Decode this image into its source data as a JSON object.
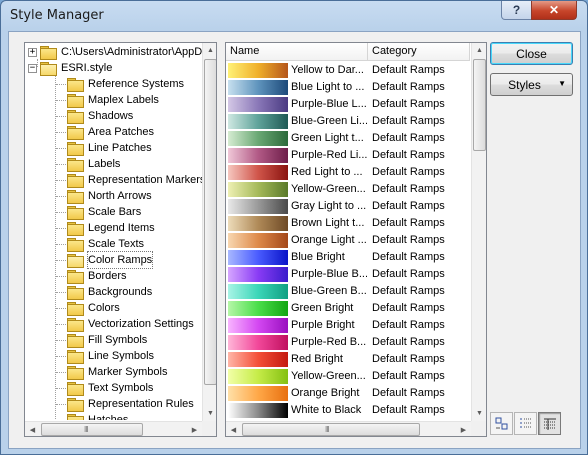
{
  "window": {
    "title": "Style Manager",
    "help_glyph": "?",
    "close_glyph": "✕"
  },
  "tree": {
    "root_path": "C:\\Users\\Administrator\\AppD",
    "style_file": "ESRI.style",
    "items": [
      "Reference Systems",
      "Maplex Labels",
      "Shadows",
      "Area Patches",
      "Line Patches",
      "Labels",
      "Representation Markers",
      "North Arrows",
      "Scale Bars",
      "Legend Items",
      "Scale Texts",
      "Color Ramps",
      "Borders",
      "Backgrounds",
      "Colors",
      "Vectorization Settings",
      "Fill Symbols",
      "Line Symbols",
      "Marker Symbols",
      "Text Symbols",
      "Representation Rules",
      "Hatches"
    ],
    "selected_item": "Color Ramps"
  },
  "list": {
    "columns": [
      "Name",
      "Category"
    ],
    "rows": [
      {
        "name": "Yellow to Dar...",
        "category": "Default Ramps",
        "colors": [
          "#fff176",
          "#f0b02a",
          "#b5561b"
        ]
      },
      {
        "name": "Blue Light to ...",
        "category": "Default Ramps",
        "colors": [
          "#c7e0ef",
          "#5f94bd",
          "#1d4a7a"
        ]
      },
      {
        "name": "Purple-Blue L...",
        "category": "Default Ramps",
        "colors": [
          "#d4c8e6",
          "#8a78b8",
          "#4a3a82"
        ]
      },
      {
        "name": "Blue-Green Li...",
        "category": "Default Ramps",
        "colors": [
          "#cfe8e2",
          "#5fa39a",
          "#1f5a55"
        ]
      },
      {
        "name": "Green Light t...",
        "category": "Default Ramps",
        "colors": [
          "#d6ecd2",
          "#6aa874",
          "#2c6b3b"
        ]
      },
      {
        "name": "Purple-Red Li...",
        "category": "Default Ramps",
        "colors": [
          "#f0c8d8",
          "#b25a86",
          "#6e1e4a"
        ]
      },
      {
        "name": "Red Light to ...",
        "category": "Default Ramps",
        "colors": [
          "#f6c7c0",
          "#d0554a",
          "#8a1410"
        ]
      },
      {
        "name": "Yellow-Green...",
        "category": "Default Ramps",
        "colors": [
          "#eef0b4",
          "#a6ba5a",
          "#5a7a2a"
        ]
      },
      {
        "name": "Gray Light to ...",
        "category": "Default Ramps",
        "colors": [
          "#e8e8e8",
          "#9a9a9a",
          "#4a4a4a"
        ]
      },
      {
        "name": "Brown Light t...",
        "category": "Default Ramps",
        "colors": [
          "#eddcba",
          "#b08a58",
          "#6e4a26"
        ]
      },
      {
        "name": "Orange Light ...",
        "category": "Default Ramps",
        "colors": [
          "#f8d7b0",
          "#de8a4a",
          "#a4481a"
        ]
      },
      {
        "name": "Blue Bright",
        "category": "Default Ramps",
        "colors": [
          "#a8b8ff",
          "#4a5cff",
          "#0a14c8"
        ]
      },
      {
        "name": "Purple-Blue B...",
        "category": "Default Ramps",
        "colors": [
          "#d6a6ff",
          "#8a3cf5",
          "#3a1ccc"
        ]
      },
      {
        "name": "Blue-Green B...",
        "category": "Default Ramps",
        "colors": [
          "#a8f4e6",
          "#3cd6b8",
          "#10a082"
        ]
      },
      {
        "name": "Green Bright",
        "category": "Default Ramps",
        "colors": [
          "#b6f7a8",
          "#4ade4a",
          "#12a612"
        ]
      },
      {
        "name": "Purple Bright",
        "category": "Default Ramps",
        "colors": [
          "#f8b4ff",
          "#d448f2",
          "#9a10c0"
        ]
      },
      {
        "name": "Purple-Red B...",
        "category": "Default Ramps",
        "colors": [
          "#ffb6d8",
          "#f2489a",
          "#c01060"
        ]
      },
      {
        "name": "Red Bright",
        "category": "Default Ramps",
        "colors": [
          "#ffb6a8",
          "#f45038",
          "#c41a10"
        ]
      },
      {
        "name": "Yellow-Green...",
        "category": "Default Ramps",
        "colors": [
          "#f2ffa8",
          "#c6ec48",
          "#84c012"
        ]
      },
      {
        "name": "Orange Bright",
        "category": "Default Ramps",
        "colors": [
          "#ffe0a8",
          "#ffa848",
          "#e87010"
        ]
      },
      {
        "name": "White to Black",
        "category": "Default Ramps",
        "colors": [
          "#ffffff",
          "#8a8a8a",
          "#000000"
        ]
      }
    ]
  },
  "buttons": {
    "close": "Close",
    "styles": "Styles"
  },
  "view_buttons": [
    "large-icons-view",
    "list-view",
    "details-view"
  ]
}
